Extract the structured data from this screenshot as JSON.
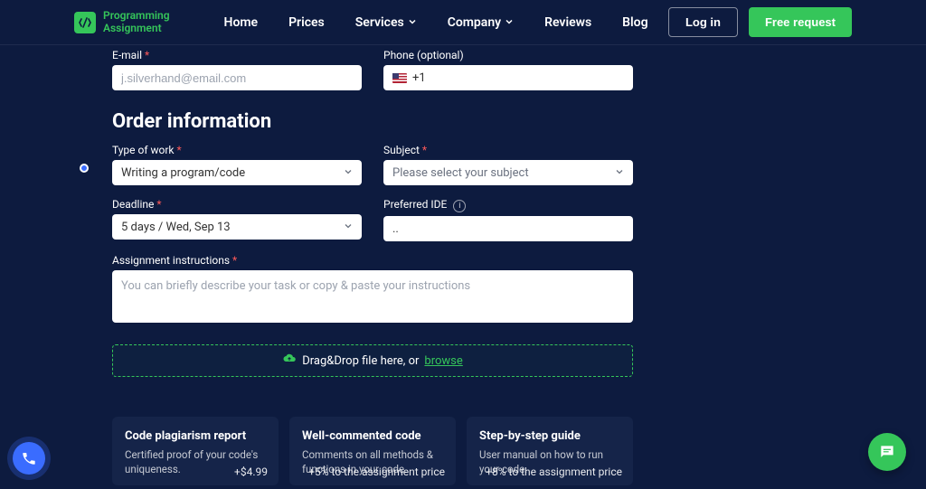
{
  "brand": {
    "name": "Programming\nAssignment"
  },
  "nav": {
    "home": "Home",
    "prices": "Prices",
    "services": "Services",
    "company": "Company",
    "reviews": "Reviews",
    "blog": "Blog"
  },
  "header_buttons": {
    "login": "Log in",
    "free_request": "Free request"
  },
  "top_row": {
    "email_label": "E-mail",
    "email_placeholder": "j.silverhand@email.com",
    "phone_label": "Phone (optional)",
    "phone_value": "+1"
  },
  "section_title": "Order information",
  "fields": {
    "type_of_work_label": "Type of work",
    "type_of_work_value": "Writing a program/code",
    "subject_label": "Subject",
    "subject_placeholder": "Please select your subject",
    "deadline_label": "Deadline",
    "deadline_value": "5 days / Wed, Sep 13",
    "ide_label": "Preferred IDE",
    "ide_value": "..",
    "instructions_label": "Assignment instructions",
    "instructions_placeholder": "You can briefly describe your task or copy & paste your instructions"
  },
  "dropzone": {
    "text": "Drag&Drop file here, or ",
    "browse": "browse"
  },
  "cards": [
    {
      "title": "Code plagiarism report",
      "desc": "Certified proof of your code's uniqueness.",
      "price": "+$4.99"
    },
    {
      "title": "Well-commented code",
      "desc": "Comments on all methods & functions in your code.",
      "price": "+5% to the assignment price"
    },
    {
      "title": "Step-by-step guide",
      "desc": "User manual on how to run your code.",
      "price": "+8% to the assignment price"
    }
  ]
}
